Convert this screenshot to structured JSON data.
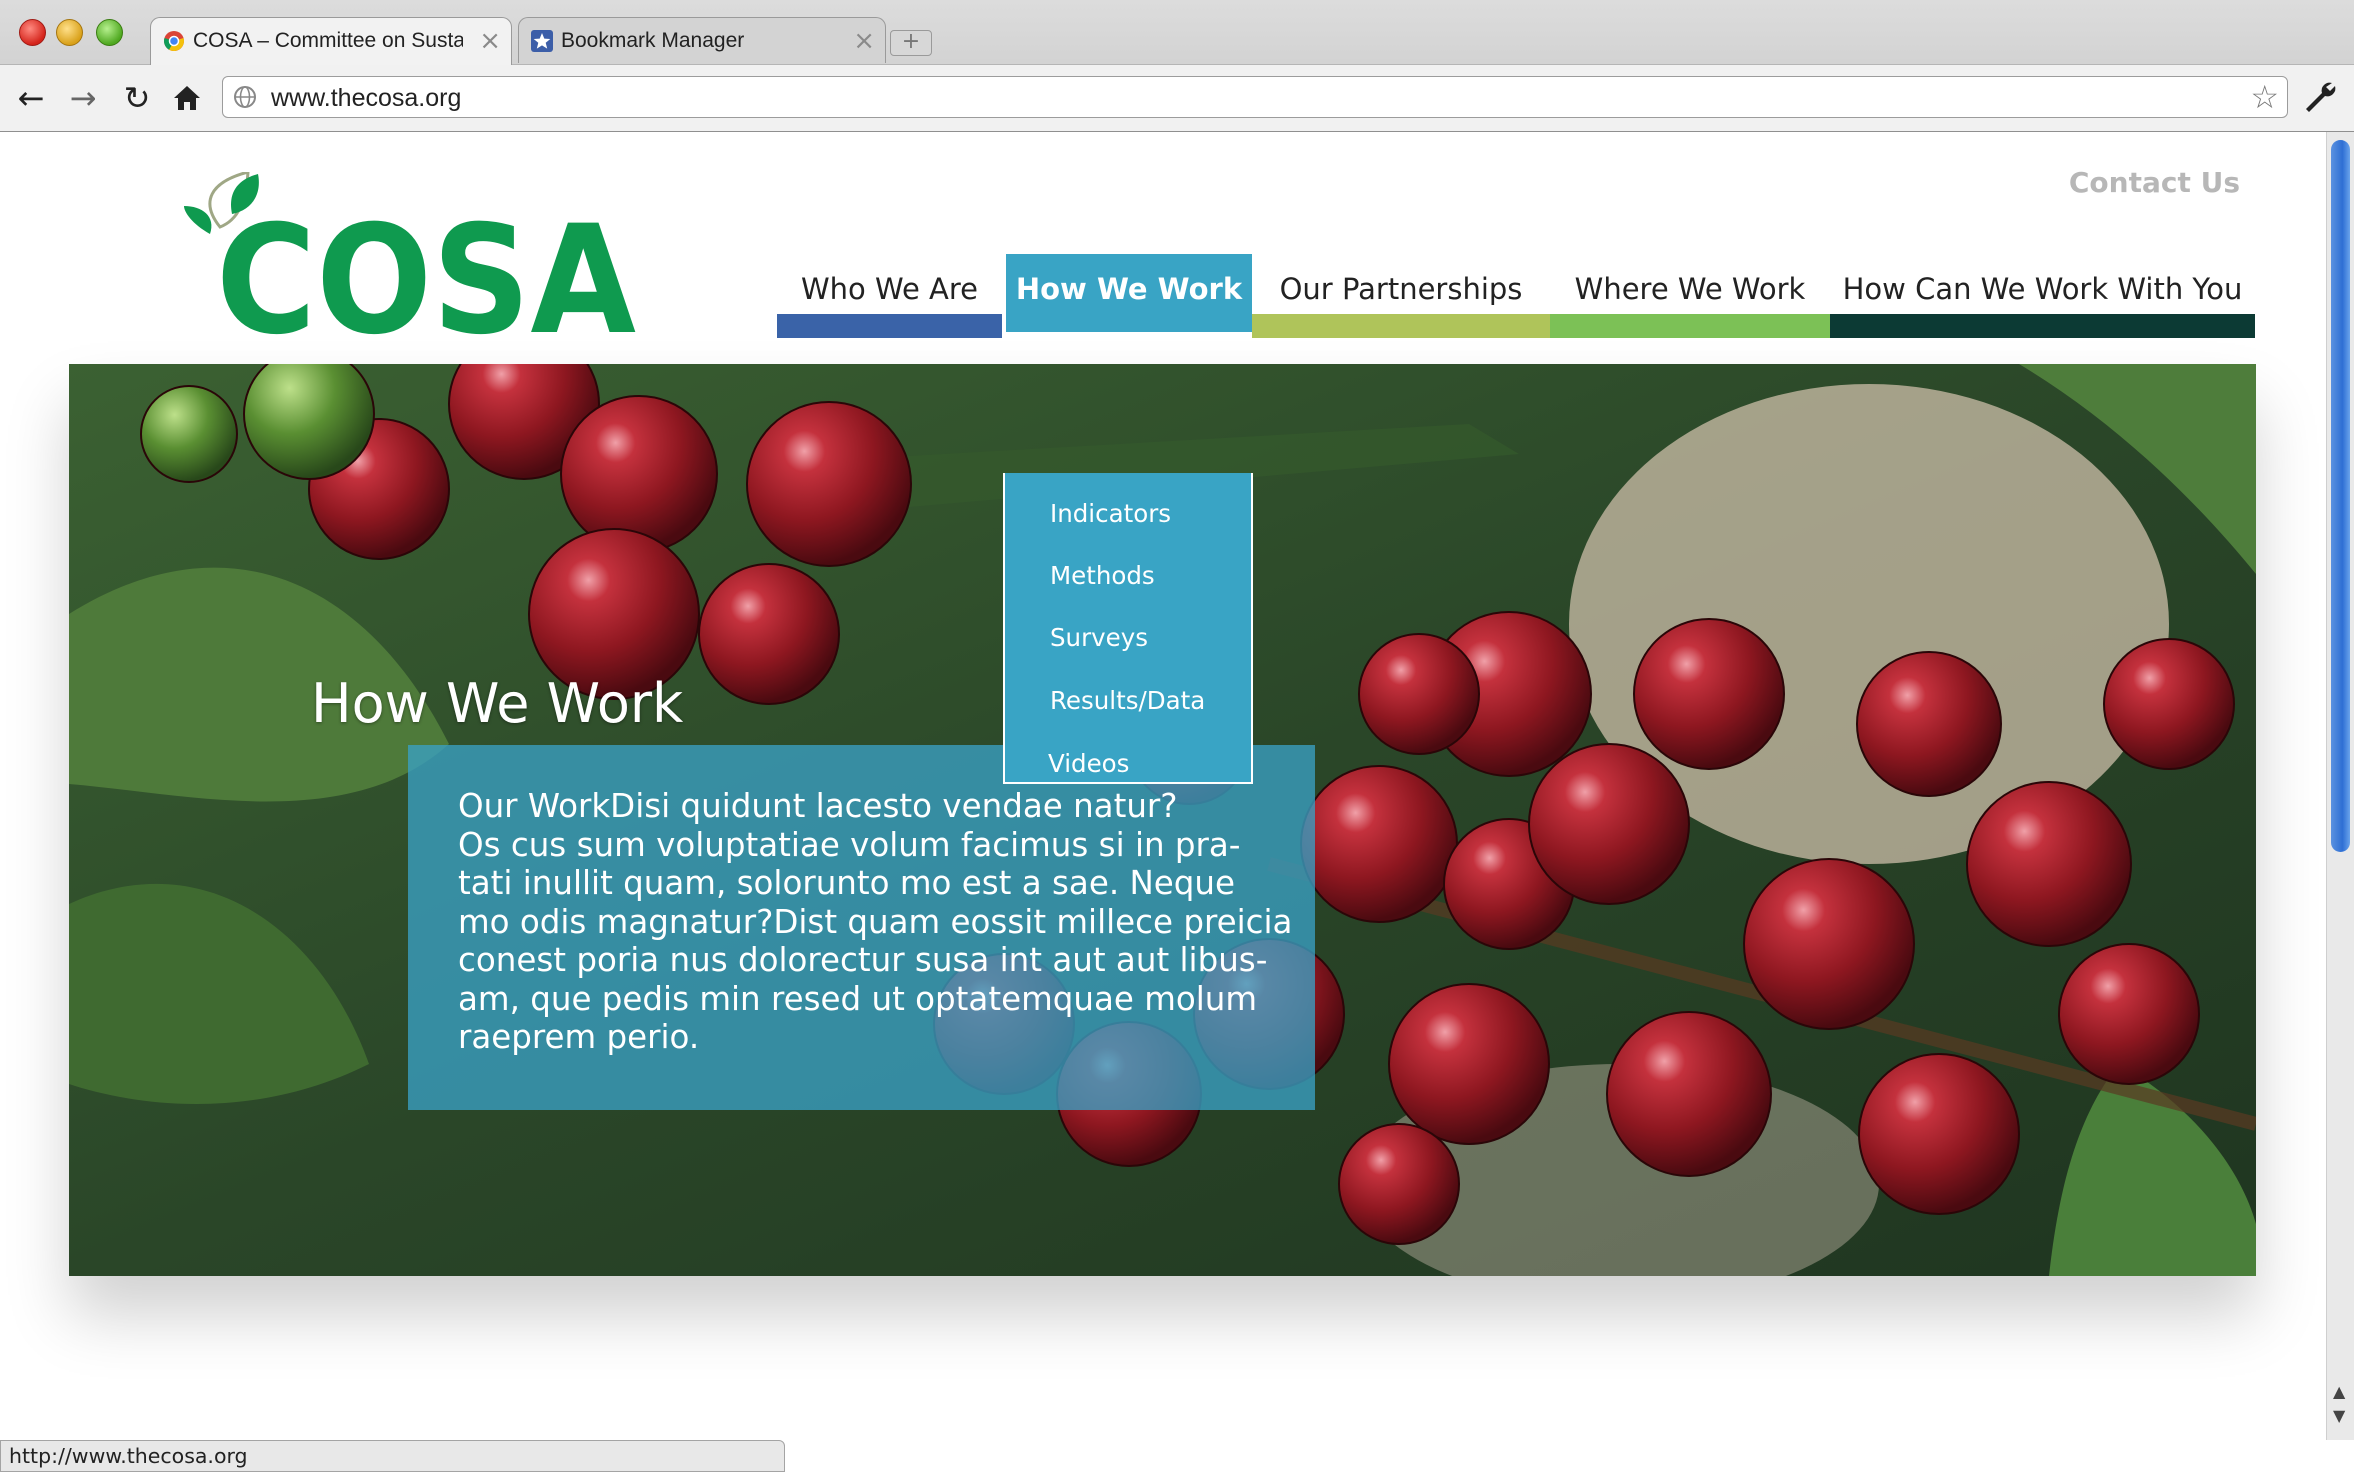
{
  "browser": {
    "tabs": [
      {
        "title": "COSA – Committee on Susta",
        "icon": "chrome-icon"
      },
      {
        "title": "Bookmark Manager",
        "icon": "bookmark-star-icon"
      }
    ],
    "new_tab_label": "+",
    "url": "www.thecosa.org",
    "status_url": "http://www.thecosa.org"
  },
  "header": {
    "logo_text": "COSA",
    "contact_label": "Contact Us"
  },
  "nav": {
    "items": [
      {
        "label": "Who We Are",
        "color": "#3a63a8"
      },
      {
        "label": "How We Work",
        "color": "#39a4c5"
      },
      {
        "label": "Our Partnerships",
        "color": "#afc45a"
      },
      {
        "label": "Where We Work",
        "color": "#7cc156"
      },
      {
        "label": "How Can We Work With You",
        "color": "#0c3a34"
      }
    ],
    "active_index": 1,
    "dropdown": [
      "Indicators",
      "Methods",
      "Surveys",
      "Results/Data",
      "Videos"
    ]
  },
  "hero": {
    "title": "How We Work",
    "lines": [
      "Our WorkDisi quidunt lacesto vendae natur?",
      "Os cus sum voluptatiae volum facimus si in pra-",
      "tati inullit quam, solorunto mo est a sae. Neque",
      "mo odis magnatur?Dist quam eossit millece preicia",
      "conest poria nus dolorectur susa int aut aut libus-",
      "am, que pedis min resed ut optatemquae molum",
      "raeprem perio."
    ]
  },
  "colors": {
    "brand_green": "#0f9a4f",
    "accent_blue": "#39a4c5"
  }
}
